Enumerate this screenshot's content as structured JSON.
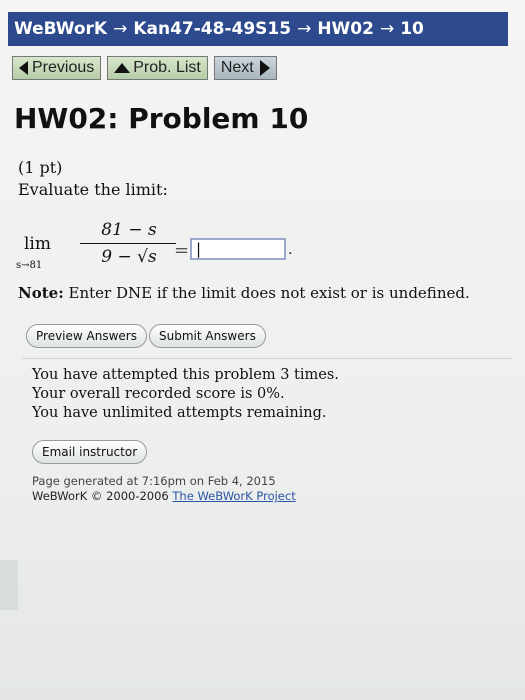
{
  "breadcrumb": [
    "WeBWorK",
    "Kan47-48-49S15",
    "HW02",
    "10"
  ],
  "breadcrumb_separator": "→",
  "nav": {
    "previous": "Previous",
    "prob_list": "Prob. List",
    "next": "Next"
  },
  "page_title": "HW02: Problem 10",
  "problem": {
    "points": "(1 pt)",
    "prompt": "Evaluate the limit:",
    "lim": "lim",
    "lim_sub": "s→81",
    "numerator": "81 − s",
    "denominator": "9 − √s",
    "equals": "=",
    "answer_value": "|",
    "period": ".",
    "note_label": "Note:",
    "note_text": " Enter DNE if the limit does not exist or is undefined."
  },
  "buttons": {
    "preview": "Preview Answers",
    "submit": "Submit Answers",
    "email": "Email instructor"
  },
  "status": {
    "attempts": "You have attempted this problem 3 times.",
    "score": "Your overall recorded score is 0%.",
    "remaining": "You have unlimited attempts remaining."
  },
  "footer": {
    "generated": "Page generated at 7:16pm on Feb 4, 2015",
    "copyright": "WeBWorK © 2000-2006 ",
    "project_link": "The WeBWorK Project"
  },
  "colors": {
    "header_bg": "#2d4a8f",
    "link": "#2a54a8"
  }
}
